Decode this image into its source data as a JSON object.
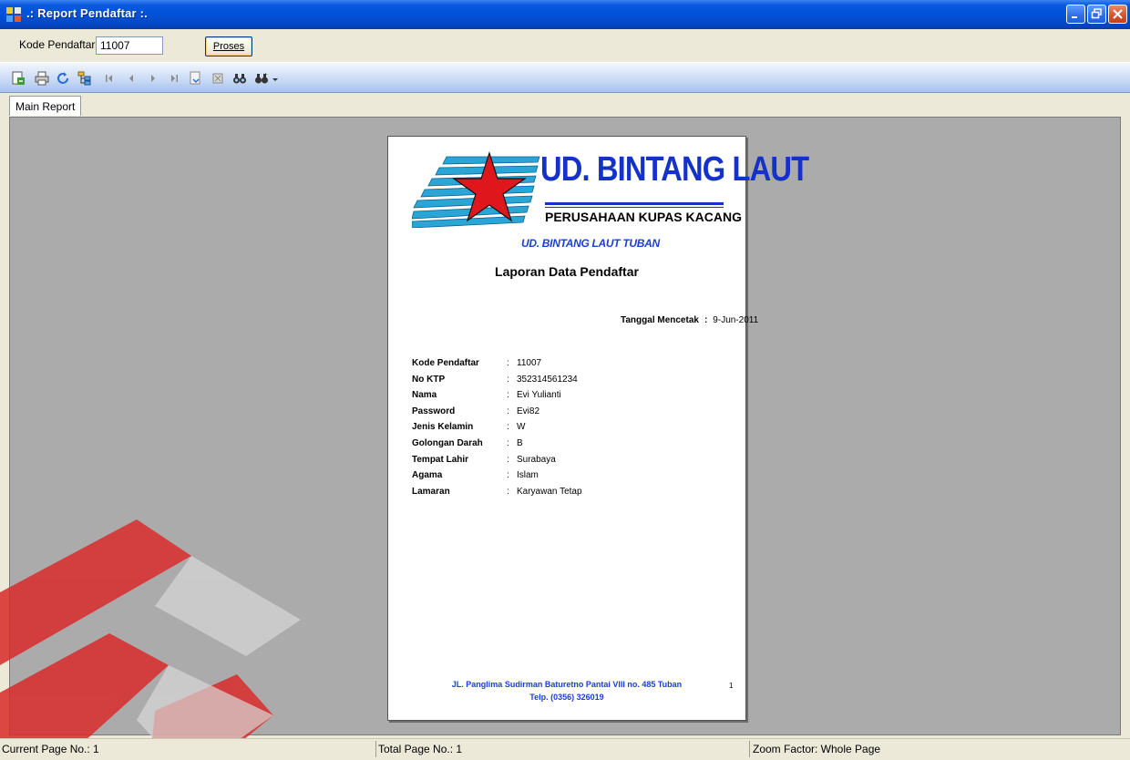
{
  "window": {
    "title": ".: Report Pendaftar :.",
    "accent_color": "#0252d8"
  },
  "parameters": {
    "kode_label": "Kode Pendaftar",
    "kode_value": "11007",
    "proses_label": "Proses"
  },
  "toolbar": {
    "icons": [
      "export-icon",
      "print-icon",
      "refresh-icon",
      "group-tree-icon",
      "first-page-icon",
      "prev-page-icon",
      "next-page-icon",
      "last-page-icon",
      "goto-page-icon",
      "stop-icon",
      "search-icon",
      "zoom-icon"
    ]
  },
  "tabs": {
    "main": "Main Report"
  },
  "report": {
    "brand_name": "UD. BINTANG LAUT",
    "brand_subtitle": "PERUSAHAAN KUPAS KACANG",
    "company_city": "UD. BINTANG LAUT TUBAN",
    "title": "Laporan Data Pendaftar",
    "print_date_label": "Tanggal Mencetak",
    "print_date_value": "9-Jun-2011",
    "fields": [
      {
        "label": "Kode Pendaftar",
        "value": "11007"
      },
      {
        "label": "No KTP",
        "value": "352314561234"
      },
      {
        "label": "Nama",
        "value": "Evi Yulianti"
      },
      {
        "label": "Password",
        "value": "Evi82"
      },
      {
        "label": "Jenis Kelamin",
        "value": "W"
      },
      {
        "label": "Golongan Darah",
        "value": "B"
      },
      {
        "label": "Tempat Lahir",
        "value": "Surabaya"
      },
      {
        "label": "Agama",
        "value": "Islam"
      },
      {
        "label": "Lamaran",
        "value": "Karyawan Tetap"
      }
    ],
    "footer_address": "JL. Panglima Sudirman Baturetno Pantai VIII no. 485 Tuban",
    "footer_phone": "Telp. (0356) 326019",
    "page_number": "1",
    "brand_color": "#1532c8",
    "logo_star_color": "#e0161d",
    "logo_stripe_color": "#2aa6d6"
  },
  "status": {
    "current_page": "Current Page No.: 1",
    "total_page": "Total Page No.: 1",
    "zoom_factor": "Zoom Factor: Whole Page"
  }
}
